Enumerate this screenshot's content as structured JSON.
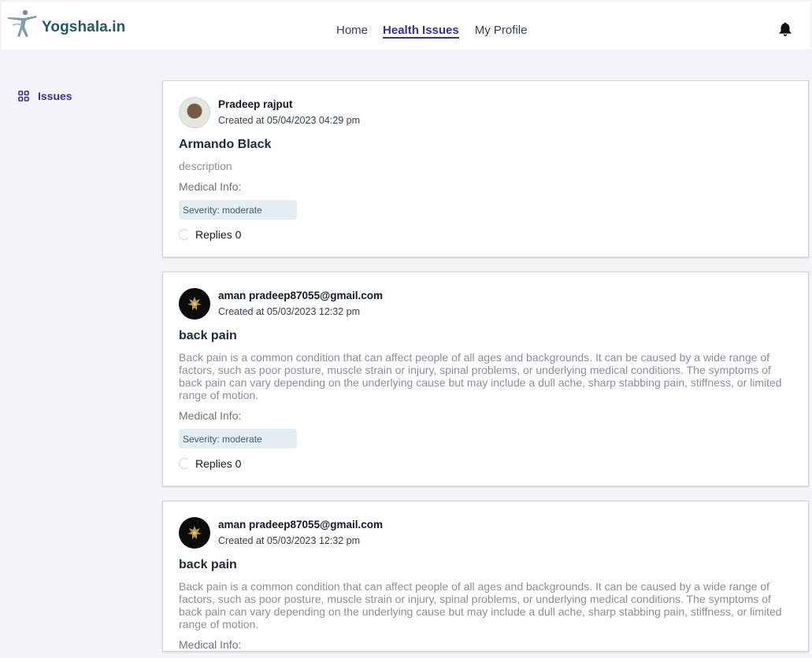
{
  "navbar": {
    "brand": "Yogshala.in",
    "links": [
      "Home",
      "Health Issues",
      "My Profile"
    ],
    "notification_icon": "bell-icon"
  },
  "sidebar": {
    "items": [
      {
        "label": "Issues",
        "icon": "issues-grid-icon"
      }
    ]
  },
  "issues": [
    {
      "author": "Pradeep rajput",
      "created": "Created at 05/04/2023 04:29 pm",
      "title": "Armando Black",
      "description": "description",
      "medical_info": "Medical Info:",
      "severity": "Severity: moderate",
      "replies": "Replies 0"
    },
    {
      "author": "aman pradeep87055@gmail.com",
      "created": "Created at 05/03/2023 12:32 pm",
      "title": "back pain",
      "description": "Back pain is a common condition that can affect people of all ages and backgrounds. It can be caused by a wide range of factors, such as poor posture, muscle strain or injury, spinal problems, or underlying medical conditions. The symptoms of back pain can vary depending on the underlying cause but may include a dull ache, sharp stabbing pain, stiffness, or limited range of motion.",
      "medical_info": "Medical Info:",
      "severity": "Severity: moderate",
      "replies": "Replies 0"
    },
    {
      "author": "aman pradeep87055@gmail.com",
      "created": "Created at 05/03/2023 12:32 pm",
      "title": "back pain",
      "description": "Back pain is a common condition that can affect people of all ages and backgrounds. It can be caused by a wide range of factors, such as poor posture, muscle strain or injury, spinal problems, or underlying medical conditions. The symptoms of back pain can vary depending on the underlying cause but may include a dull ache, sharp stabbing pain, stiffness, or limited range of motion.",
      "medical_info": "Medical Info:"
    }
  ],
  "colors": {
    "accent": "#3730a3",
    "brand": "#1f5a6b",
    "badge_bg": "#e5eef2"
  }
}
